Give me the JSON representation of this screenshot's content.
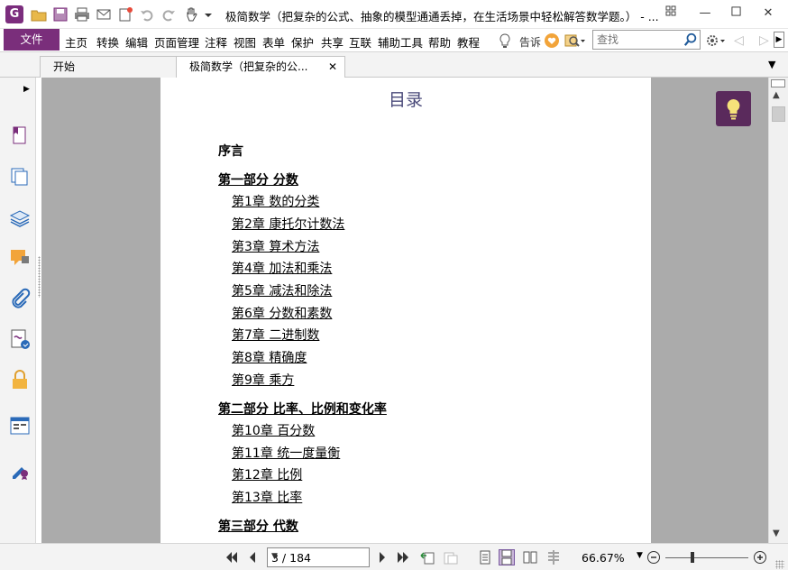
{
  "window": {
    "title": "极简数学（把复杂的公式、抽象的模型通通丢掉，在生活场景中轻松解答数学题。） - ...",
    "app_logo": "G"
  },
  "menu": {
    "file": "文件",
    "items": [
      "主页",
      "转换",
      "编辑",
      "页面管理",
      "注释",
      "视图",
      "表单",
      "保护",
      "共享",
      "互联",
      "辅助工具",
      "帮助",
      "教程"
    ],
    "tell_me": "告诉",
    "search_placeholder": "查找"
  },
  "tabs": [
    {
      "label": "开始"
    },
    {
      "label": "极简数学（把复杂的公...",
      "close": "✕"
    }
  ],
  "document": {
    "toc_title": "目录",
    "entries": [
      {
        "text": "序言",
        "kind": "preface"
      },
      {
        "text": "第一部分 分数",
        "kind": "part"
      },
      {
        "text": "第1章 数的分类",
        "kind": "chapter"
      },
      {
        "text": "第2章 康托尔计数法",
        "kind": "chapter"
      },
      {
        "text": "第3章 算术方法",
        "kind": "chapter"
      },
      {
        "text": "第4章 加法和乘法",
        "kind": "chapter"
      },
      {
        "text": "第5章 减法和除法",
        "kind": "chapter"
      },
      {
        "text": "第6章 分数和素数",
        "kind": "chapter"
      },
      {
        "text": "第7章 二进制数",
        "kind": "chapter"
      },
      {
        "text": "第8章 精确度",
        "kind": "chapter"
      },
      {
        "text": "第9章 乘方",
        "kind": "chapter"
      },
      {
        "text": "第二部分 比率、比例和变化率",
        "kind": "part"
      },
      {
        "text": "第10章 百分数",
        "kind": "chapter"
      },
      {
        "text": "第11章 统一度量衡",
        "kind": "chapter"
      },
      {
        "text": "第12章 比例",
        "kind": "chapter"
      },
      {
        "text": "第13章 比率",
        "kind": "chapter"
      },
      {
        "text": "第三部分 代数",
        "kind": "part"
      }
    ]
  },
  "status": {
    "page_indicator": "3 / 184",
    "zoom": "66.67%"
  },
  "colors": {
    "brand": "#7a2e7b",
    "doc_background": "#ababab",
    "tip_button": "#5a2a5c"
  },
  "sidebar_icons": [
    "bookmark-icon",
    "pages-icon",
    "layers-icon",
    "comments-icon",
    "attachments-icon",
    "signature-icon",
    "security-icon",
    "form-fields-icon",
    "certificate-icon"
  ]
}
